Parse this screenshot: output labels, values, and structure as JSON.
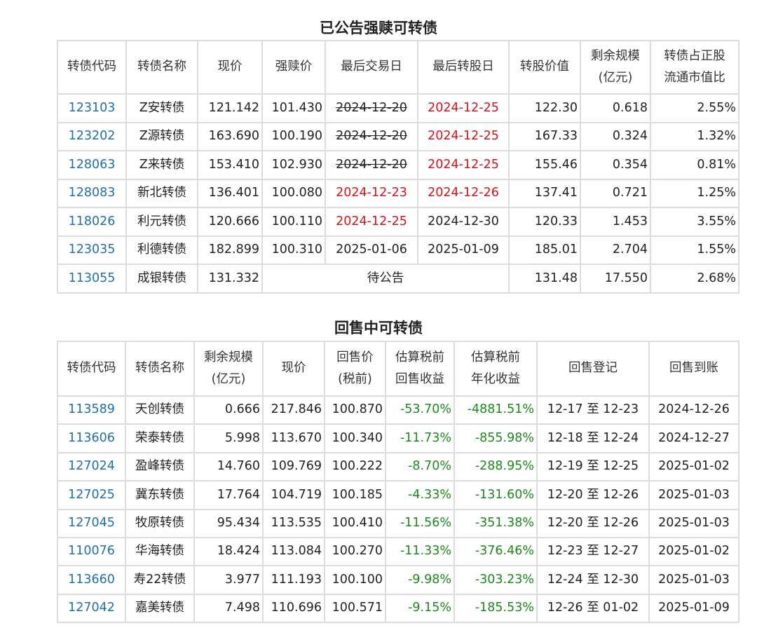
{
  "section1": {
    "title": "已公告强赎可转债",
    "headers": [
      "转债代码",
      "转债名称",
      "现价",
      "强赎价",
      "最后交易日",
      "最后转股日",
      "转股价值",
      "剩余规模\n(亿元)",
      "转债占正股\n流通市值比"
    ],
    "rows": [
      [
        "123103",
        "Z安转债",
        "121.142",
        "101.430",
        "2024-12-20",
        "2024-12-25",
        "122.30",
        "0.618",
        "2.55%"
      ],
      [
        "123202",
        "Z源转债",
        "163.690",
        "100.190",
        "2024-12-20",
        "2024-12-25",
        "167.33",
        "0.324",
        "1.32%"
      ],
      [
        "128063",
        "Z来转债",
        "153.410",
        "102.930",
        "2024-12-20",
        "2024-12-25",
        "155.46",
        "0.354",
        "0.81%"
      ],
      [
        "128083",
        "新北转债",
        "136.401",
        "100.080",
        "2024-12-23",
        "2024-12-26",
        "137.41",
        "0.721",
        "1.25%"
      ],
      [
        "118026",
        "利元转债",
        "120.666",
        "100.110",
        "2024-12-25",
        "2024-12-30",
        "120.33",
        "1.453",
        "3.55%"
      ],
      [
        "123035",
        "利德转债",
        "182.899",
        "100.310",
        "2025-01-06",
        "2025-01-09",
        "185.01",
        "2.704",
        "1.55%"
      ],
      [
        "113055",
        "成银转债",
        "131.332",
        "待公告",
        "131.48",
        "17.550",
        "2.68%"
      ]
    ]
  },
  "section2": {
    "title": "回售中可转债",
    "headers": [
      "转债代码",
      "转债名称",
      "剩余规模\n(亿元)",
      "现价",
      "回售价\n(税前)",
      "估算税前\n回售收益",
      "估算税前\n年化收益",
      "回售登记",
      "回售到账"
    ],
    "rows": [
      [
        "113589",
        "天创转债",
        "0.666",
        "217.846",
        "100.870",
        "-53.70%",
        "-4881.51%",
        "12-17 至 12-23",
        "2024-12-26"
      ],
      [
        "113606",
        "荣泰转债",
        "5.998",
        "113.670",
        "100.340",
        "-11.73%",
        "-855.98%",
        "12-18 至 12-24",
        "2024-12-27"
      ],
      [
        "127024",
        "盈峰转债",
        "14.760",
        "109.769",
        "100.222",
        "-8.70%",
        "-288.95%",
        "12-19 至 12-25",
        "2025-01-02"
      ],
      [
        "127025",
        "冀东转债",
        "17.764",
        "104.719",
        "100.185",
        "-4.33%",
        "-131.60%",
        "12-20 至 12-26",
        "2025-01-03"
      ],
      [
        "127045",
        "牧原转债",
        "95.434",
        "113.535",
        "100.410",
        "-11.56%",
        "-351.38%",
        "12-20 至 12-26",
        "2025-01-03"
      ],
      [
        "110076",
        "华海转债",
        "18.424",
        "113.084",
        "100.270",
        "-11.33%",
        "-376.46%",
        "12-23 至 12-27",
        "2025-01-02"
      ],
      [
        "113660",
        "寿22转债",
        "3.977",
        "111.193",
        "100.100",
        "-9.98%",
        "-303.23%",
        "12-24 至 12-30",
        "2025-01-03"
      ],
      [
        "127042",
        "嘉美转债",
        "7.498",
        "110.696",
        "100.571",
        "-9.15%",
        "-185.53%",
        "12-26 至 01-02",
        "2025-01-09"
      ]
    ]
  },
  "colors": {
    "code": "#2170a8",
    "red": "#d4141c",
    "green": "#1d8a1d",
    "border": "#dcdcdc"
  }
}
